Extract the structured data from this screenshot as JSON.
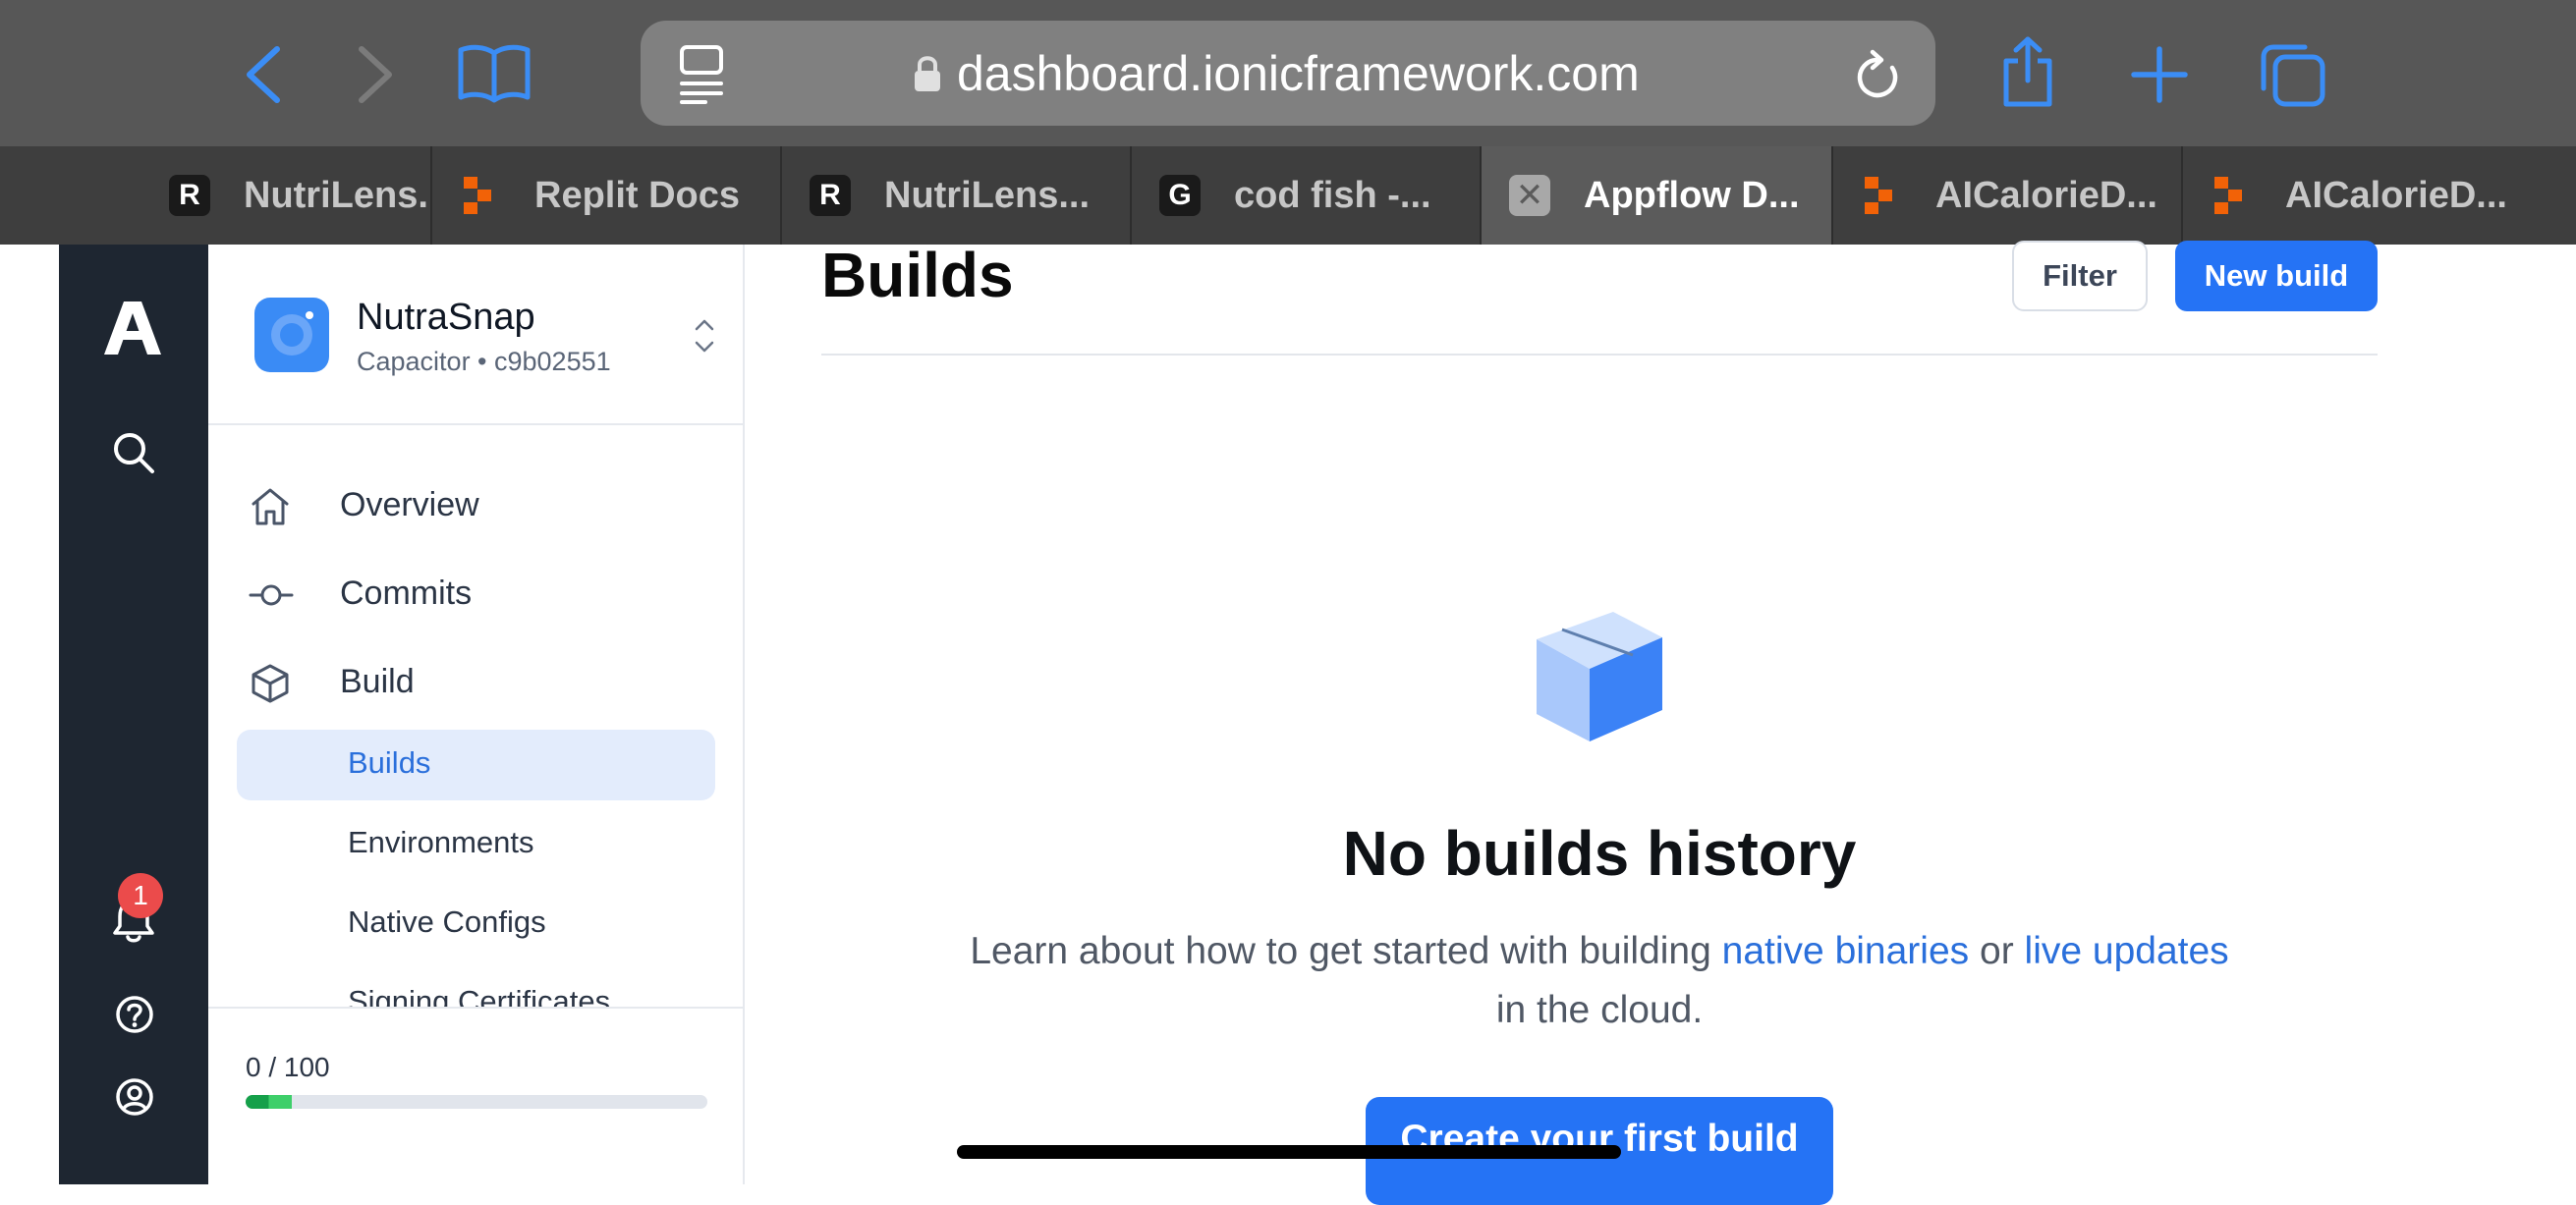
{
  "browser": {
    "url": "dashboard.ionicframework.com",
    "tabs": [
      {
        "label": "NutriLens..",
        "icon_letter": "R",
        "icon": "replit-r-icon"
      },
      {
        "label": "Replit Docs",
        "icon": "replit-logo-icon"
      },
      {
        "label": "NutriLens...",
        "icon_letter": "R",
        "icon": "replit-r-icon"
      },
      {
        "label": "cod fish -...",
        "icon_letter": "G",
        "icon": "google-g-icon"
      },
      {
        "label": "Appflow D...",
        "icon_letter": "✕",
        "icon": "close-tab-icon",
        "active": true
      },
      {
        "label": "AICalorieD...",
        "icon": "replit-logo-icon"
      },
      {
        "label": "AICalorieD...",
        "icon": "replit-logo-icon"
      }
    ]
  },
  "rail": {
    "notification_count": "1",
    "icons": [
      "appflow-logo-icon",
      "search-icon",
      "bell-icon",
      "help-icon",
      "account-icon"
    ]
  },
  "project": {
    "name": "NutraSnap",
    "subtitle": "Capacitor • c9b02551"
  },
  "nav": {
    "items": [
      {
        "label": "Overview",
        "icon": "home-icon"
      },
      {
        "label": "Commits",
        "icon": "commit-icon"
      },
      {
        "label": "Build",
        "icon": "cube-icon"
      }
    ],
    "build_sub": [
      {
        "label": "Builds",
        "active": true
      },
      {
        "label": "Environments"
      },
      {
        "label": "Native Configs"
      },
      {
        "label": "Signing Certificates"
      }
    ]
  },
  "usage": {
    "text": "0 / 100",
    "fill_fraction": 0.1
  },
  "main": {
    "title": "Builds",
    "filter_label": "Filter",
    "new_build_label": "New build",
    "empty_title": "No builds history",
    "empty_desc_pre": "Learn about how to get started with building",
    "link_native": "native binaries",
    "empty_desc_mid": "or",
    "link_live": "live updates",
    "empty_desc_post": "in the cloud.",
    "cta_label": "Create your first build"
  },
  "colors": {
    "accent": "#2573f5",
    "rail": "#1e2631",
    "badge": "#eb4b4b",
    "link": "#2a6fdb"
  }
}
